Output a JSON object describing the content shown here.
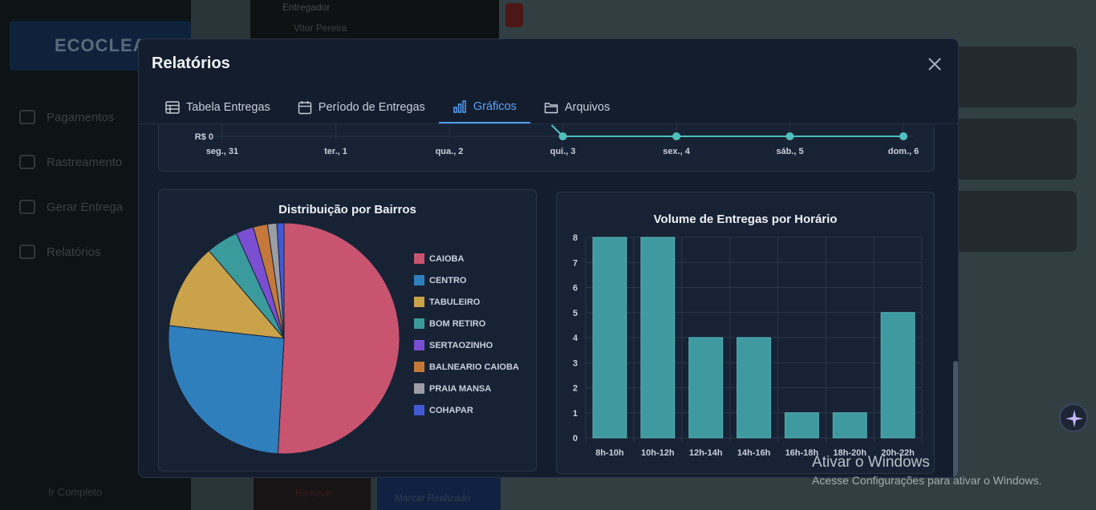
{
  "background": {
    "logo_text": "ECOCLEAN",
    "nav": [
      {
        "label": "Pagamentos",
        "icon": "wallet-icon"
      },
      {
        "label": "Rastreamento",
        "icon": "clock-icon"
      },
      {
        "label": "Gerar Entrega",
        "icon": "truck-icon"
      },
      {
        "label": "Relatórios",
        "icon": "document-icon"
      }
    ],
    "topbar_label": "Entregador",
    "topbar_value": "Vitor Pereira",
    "bottom_left": "Ir Completo",
    "bottom_btn1": "Remover",
    "bottom_btn2": "Marcar Realizado"
  },
  "modal": {
    "title": "Relatórios",
    "tabs": [
      {
        "label": "Tabela Entregas",
        "icon": "table-icon",
        "active": false
      },
      {
        "label": "Período de Entregas",
        "icon": "calendar-icon",
        "active": false
      },
      {
        "label": "Gráficos",
        "icon": "bar-chart-icon",
        "active": true
      },
      {
        "label": "Arquivos",
        "icon": "folder-icon",
        "active": false
      }
    ]
  },
  "chart_data": [
    {
      "type": "line",
      "title": "",
      "y_tick_visible": "R$ 0",
      "categories": [
        "seg., 31",
        "ter., 1",
        "qua., 2",
        "qui., 3",
        "sex., 4",
        "sáb., 5",
        "dom., 6"
      ],
      "values": [
        null,
        null,
        null,
        0,
        0,
        0,
        0
      ],
      "color": "#4fc0bd"
    },
    {
      "type": "pie",
      "title": "Distribuição por Bairros",
      "legend_position": "right",
      "labels": [
        "CAIOBA",
        "CENTRO",
        "TABULEIRO",
        "BOM RETIRO",
        "SERTAOZINHO",
        "BALNEARIO CAIOBA",
        "PRAIA MANSA",
        "COHAPAR"
      ],
      "values": [
        51,
        26,
        12,
        4.5,
        2.5,
        2,
        1.3,
        1
      ],
      "colors": [
        "#c85470",
        "#2f7fbc",
        "#c9a24a",
        "#3b9a9b",
        "#7a4fd1",
        "#c4793b",
        "#9a9da3",
        "#4259d6"
      ]
    },
    {
      "type": "bar",
      "title": "Volume de Entregas por Horário",
      "categories": [
        "8h-10h",
        "10h-12h",
        "12h-14h",
        "14h-16h",
        "16h-18h",
        "18h-20h",
        "20h-22h"
      ],
      "values": [
        8,
        8,
        4,
        4,
        1,
        1,
        5
      ],
      "ylim": [
        0,
        8
      ],
      "yticks": [
        "0",
        "1",
        "2",
        "3",
        "4",
        "5",
        "6",
        "7",
        "8"
      ],
      "grid": true,
      "color": "#3e9a9f"
    }
  ],
  "watermark": {
    "line1": "Ativar o Windows",
    "line2": "Acesse Configurações para ativar o Windows."
  }
}
